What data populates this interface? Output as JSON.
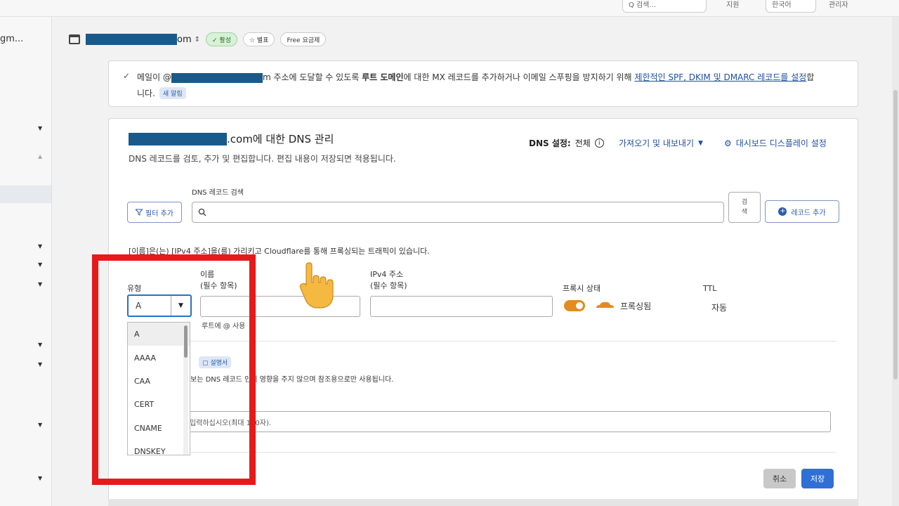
{
  "topbar": {
    "search_label": "Q 검색...",
    "link1": "지원",
    "link2": "한국어",
    "link3": "관리자"
  },
  "sidebar": {
    "account_name": "gm..."
  },
  "header": {
    "domain_suffix": "om",
    "badge_active": "✓ 활성",
    "badge_star": "☆ 별표",
    "badge_plan": "Free 요금제"
  },
  "notice": {
    "line1_prefix": "메일이 @",
    "line1_mid": "m 주소에 도달할 수 있도록 ",
    "line1_bold": "루트 도메인",
    "line1_tail": "에 대한 MX 레코드를 추가하거나 이메일 스푸핑을 방지하기 위해 ",
    "line1_link": "제한적인 SPF, DKIM 및 DMARC 레코드를 설정",
    "line1_end": "합",
    "line2_text": "니다.",
    "line2_tag": "새 알림"
  },
  "dns": {
    "title_suffix": ".com에 대한 DNS 관리",
    "subtitle": "DNS 레코드를 검토, 추가 및 편집합니다. 편집 내용이 저장되면 적용됩니다.",
    "settings_label": "DNS 설정:",
    "settings_value": "전체",
    "import_export": "가져오기 및 내보내기",
    "dashboard_settings": "대시보드 디스플레이 설정",
    "search_label": "DNS 레코드 검색",
    "filter_button": "필터 추가",
    "search_button": "검색",
    "add_record_button": "레코드 추가"
  },
  "form": {
    "proxy_desc": "[이름]은(는) [IPv4 주소]을(를) 가리키고 Cloudflare를 통해 프록싱되는 트래픽이 있습니다.",
    "type_label": "유형",
    "type_value": "A",
    "name_label": "이름",
    "name_required": "(필수 항목)",
    "ipv4_label": "IPv4 주소",
    "ipv4_required": "(필수 항목)",
    "proxy_label": "프록시 상태",
    "proxy_value": "프록싱됨",
    "ttl_label": "TTL",
    "ttl_value": "자동",
    "root_hint": "루트에 @ 사용",
    "manual_tag": "설명서",
    "comment_desc": "보는 DNS 레코드 인에 영향을 주지 않으며 참조용으로만 사용됩니다.",
    "comment_placeholder": "입력하십시오(최대 100자).",
    "cancel_button": "취소",
    "save_button": "저장"
  },
  "dropdown": {
    "options": [
      "A",
      "AAAA",
      "CAA",
      "CERT",
      "CNAME",
      "DNSKEY"
    ]
  },
  "colors": {
    "accent": "#2f6fd6",
    "highlight": "#e51a1a",
    "proxy_orange": "#e48a1f",
    "redaction": "#1a5a8a"
  }
}
